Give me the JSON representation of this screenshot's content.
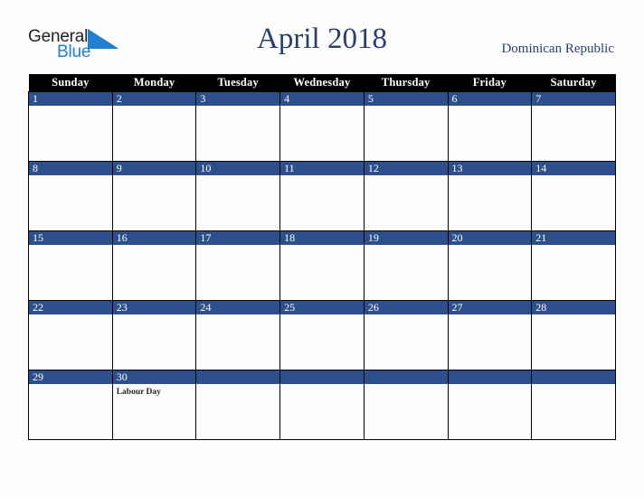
{
  "brand": {
    "name_part1": "General",
    "name_part2": "Blue",
    "triangle_color": "#1f7fd0",
    "text_color": "#231f20",
    "blue_color": "#1f7fd0"
  },
  "header": {
    "title": "April 2018",
    "country": "Dominican Republic",
    "title_color": "#2b3f6b"
  },
  "calendar": {
    "weekday_headers": [
      "Sunday",
      "Monday",
      "Tuesday",
      "Wednesday",
      "Thursday",
      "Friday",
      "Saturday"
    ],
    "header_bg": "#000000",
    "header_text_color": "#ffffff",
    "daybar_bg": "#2d4f8c",
    "daybar_text_color": "#ffffff",
    "cell_bg": "#fdfdfd",
    "grid_line_color": "#000000",
    "weeks": [
      [
        {
          "day": "1",
          "event": ""
        },
        {
          "day": "2",
          "event": ""
        },
        {
          "day": "3",
          "event": ""
        },
        {
          "day": "4",
          "event": ""
        },
        {
          "day": "5",
          "event": ""
        },
        {
          "day": "6",
          "event": ""
        },
        {
          "day": "7",
          "event": ""
        }
      ],
      [
        {
          "day": "8",
          "event": ""
        },
        {
          "day": "9",
          "event": ""
        },
        {
          "day": "10",
          "event": ""
        },
        {
          "day": "11",
          "event": ""
        },
        {
          "day": "12",
          "event": ""
        },
        {
          "day": "13",
          "event": ""
        },
        {
          "day": "14",
          "event": ""
        }
      ],
      [
        {
          "day": "15",
          "event": ""
        },
        {
          "day": "16",
          "event": ""
        },
        {
          "day": "17",
          "event": ""
        },
        {
          "day": "18",
          "event": ""
        },
        {
          "day": "19",
          "event": ""
        },
        {
          "day": "20",
          "event": ""
        },
        {
          "day": "21",
          "event": ""
        }
      ],
      [
        {
          "day": "22",
          "event": ""
        },
        {
          "day": "23",
          "event": ""
        },
        {
          "day": "24",
          "event": ""
        },
        {
          "day": "25",
          "event": ""
        },
        {
          "day": "26",
          "event": ""
        },
        {
          "day": "27",
          "event": ""
        },
        {
          "day": "28",
          "event": ""
        }
      ],
      [
        {
          "day": "29",
          "event": ""
        },
        {
          "day": "30",
          "event": "Labour Day"
        },
        {
          "day": "",
          "event": ""
        },
        {
          "day": "",
          "event": ""
        },
        {
          "day": "",
          "event": ""
        },
        {
          "day": "",
          "event": ""
        },
        {
          "day": "",
          "event": ""
        }
      ]
    ]
  }
}
